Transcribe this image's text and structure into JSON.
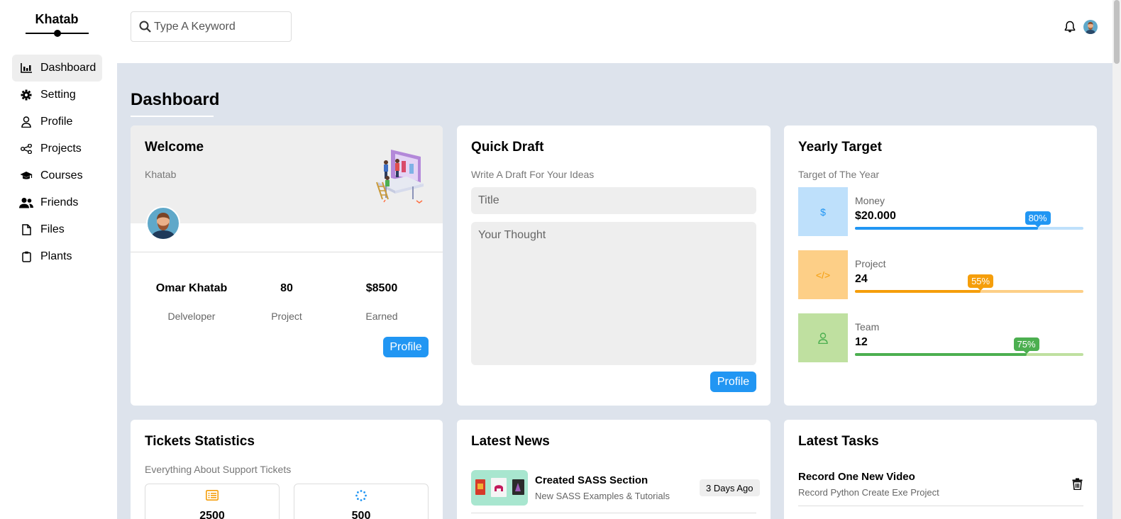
{
  "brand": {
    "name": "Khatab"
  },
  "sidebar": {
    "items": [
      {
        "label": "Dashboard",
        "icon": "chart-icon",
        "active": true
      },
      {
        "label": "Setting",
        "icon": "gear-icon"
      },
      {
        "label": "Profile",
        "icon": "user-icon"
      },
      {
        "label": "Projects",
        "icon": "share-nodes-icon"
      },
      {
        "label": "Courses",
        "icon": "graduation-cap-icon"
      },
      {
        "label": "Friends",
        "icon": "users-icon"
      },
      {
        "label": "Files",
        "icon": "file-icon"
      },
      {
        "label": "Plants",
        "icon": "clipboard-icon"
      }
    ]
  },
  "header": {
    "search_placeholder": "Type A Keyword"
  },
  "page": {
    "title": "Dashboard"
  },
  "welcome": {
    "title": "Welcome",
    "name": "Khatab",
    "stats": [
      {
        "value": "Omar Khatab",
        "label": "Delveloper"
      },
      {
        "value": "80",
        "label": "Project"
      },
      {
        "value": "$8500",
        "label": "Earned"
      }
    ],
    "button": "Profile"
  },
  "draft": {
    "title": "Quick Draft",
    "subtitle": "Write A Draft For Your Ideas",
    "title_placeholder": "Title",
    "body_placeholder": "Your Thought",
    "button": "Profile"
  },
  "target": {
    "title": "Yearly Target",
    "subtitle": "Target of The Year",
    "items": [
      {
        "label": "Money",
        "value": "$20.000",
        "percent": 80,
        "percent_label": "80%",
        "icon": "dollar-icon",
        "glyph": "$",
        "color": "#2196f3",
        "light": "#bee0fb"
      },
      {
        "label": "Project",
        "value": "24",
        "percent": 55,
        "percent_label": "55%",
        "icon": "code-icon",
        "glyph": "</>",
        "color": "#f59e0b",
        "light": "#fdcf87"
      },
      {
        "label": "Team",
        "value": "12",
        "percent": 75,
        "percent_label": "75%",
        "icon": "user-icon",
        "glyph": "",
        "color": "#4caf50",
        "light": "#bfe0a0"
      }
    ]
  },
  "tickets": {
    "title": "Tickets Statistics",
    "subtitle": "Everything About Support Tickets",
    "boxes": [
      {
        "icon": "list-icon",
        "value": "2500"
      },
      {
        "icon": "spinner-icon",
        "value": "500"
      }
    ]
  },
  "news": {
    "title": "Latest News",
    "items": [
      {
        "title": "Created SASS Section",
        "desc": "New SASS Examples & Tutorials",
        "date": "3 Days Ago"
      }
    ]
  },
  "tasks": {
    "title": "Latest Tasks",
    "items": [
      {
        "title": "Record One New Video",
        "desc": "Record Python Create Exe Project"
      }
    ]
  }
}
